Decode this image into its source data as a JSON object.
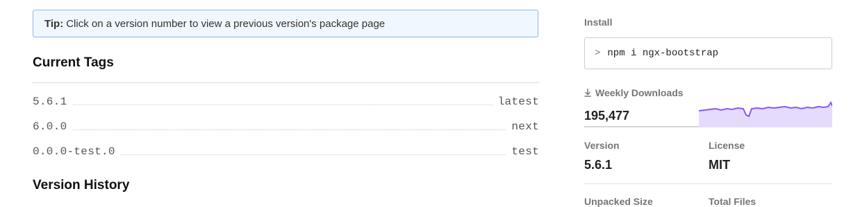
{
  "tip": {
    "label": "Tip:",
    "text": "Click on a version number to view a previous version's package page"
  },
  "current_tags": {
    "title": "Current Tags",
    "rows": [
      {
        "version": "5.6.1",
        "tag": "latest"
      },
      {
        "version": "6.0.0",
        "tag": "next"
      },
      {
        "version": "0.0.0-test.0",
        "tag": "test"
      }
    ]
  },
  "version_history": {
    "title": "Version History"
  },
  "sidebar": {
    "install_label": "Install",
    "install_command": "npm i ngx-bootstrap",
    "install_prompt": ">",
    "weekly_downloads_label": "Weekly Downloads",
    "weekly_downloads_icon": "download-icon",
    "weekly_downloads_value": "195,477",
    "sparkline_color": "#8956ff",
    "sparkline_fill": "#e5dcfd",
    "version_label": "Version",
    "version_value": "5.6.1",
    "license_label": "License",
    "license_value": "MIT",
    "unpacked_size_label": "Unpacked Size",
    "total_files_label": "Total Files"
  }
}
